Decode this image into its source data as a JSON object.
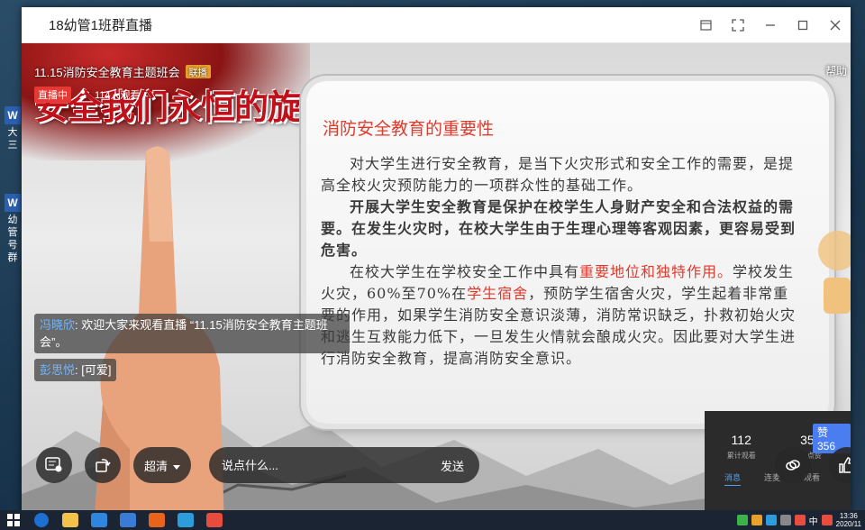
{
  "window": {
    "title": "18幼管1班群直播"
  },
  "live": {
    "name": "11.15消防安全教育主题班会",
    "tag": "联播",
    "status_badge": "直播中",
    "viewers": "114人观看",
    "help": "帮助"
  },
  "slide": {
    "banner": "安全我们永恒的旋律",
    "heading": "消防安全教育的重要性",
    "para1": "对大学生进行安全教育，是当下火灾形式和安全工作的需要，是提高全校火灾预防能力的一项群众性的基础工作。",
    "para2": "开展大学生安全教育是保护在校学生人身财产安全和合法权益的需要。在发生火灾时，在校大学生由于生理心理等客观因素，更容易受到危害。",
    "para3_a": "在校大学生在学校安全工作中具有",
    "para3_hl1": "重要地位和独特作用。",
    "para3_b": "学校发生火灾，60%至70%在",
    "para3_hl2": "学生宿舍",
    "para3_c": "，预防学生宿舍火灾，学生起着非常重要的作用，如果学生消防安全意识淡薄，消防常识缺乏，扑救初始火灾和逃生互救能力低下，一旦发生火情就会酿成火灾。因此要对大学生进行消防安全教育，提高消防安全意识。"
  },
  "chat": [
    {
      "name": "冯晓欣",
      "text": ": 欢迎大家来观看直播 “11.15消防安全教育主题班会”。"
    },
    {
      "name": "彭思悦",
      "text": ": [可爱]"
    }
  ],
  "controls": {
    "quality": "超清",
    "input_placeholder": "说点什么...",
    "send": "发送"
  },
  "stats": {
    "total_views": "112",
    "total_views_label": "累计观看",
    "likes": "3568",
    "likes_label": "点赞",
    "tab_messages": "消息",
    "tab_2": "连麦",
    "tab_3": "观看",
    "like_badge": "赞 356"
  },
  "desktop": {
    "icon1_label": "大三",
    "icon2_label": "幼管",
    "icon3_label": "号群"
  },
  "taskbar": {
    "ime": "中",
    "time": "13:36",
    "date": "2020/11"
  },
  "colors": {
    "accent_red": "#e03a2c",
    "chat_name": "#6fb6ff",
    "badge_red": "#e53935"
  }
}
